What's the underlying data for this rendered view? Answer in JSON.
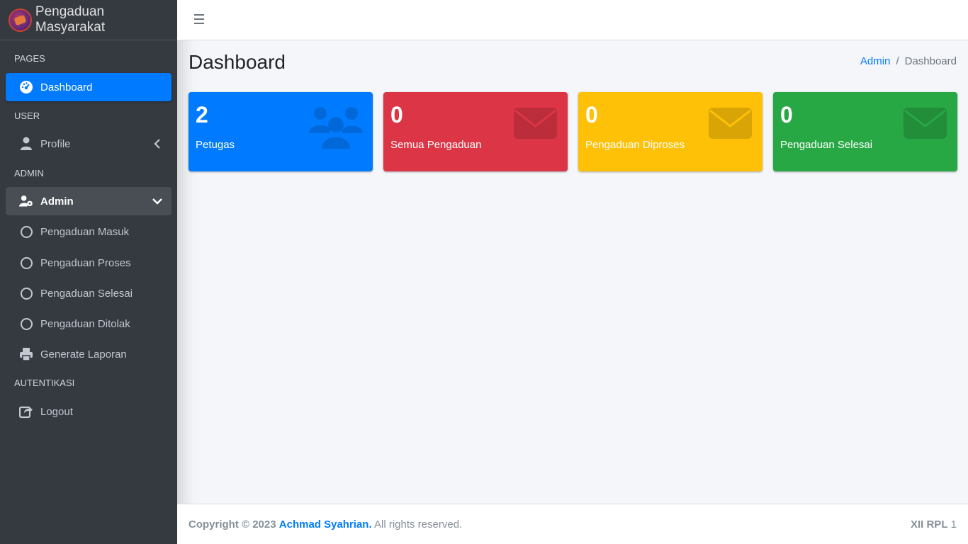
{
  "brand": {
    "title": "Pengaduan Masyarakat"
  },
  "sidebar": {
    "sections": {
      "pages": "PAGES",
      "user": "USER",
      "admin": "ADMIN",
      "auth": "AUTENTIKASI"
    },
    "items": {
      "dashboard": "Dashboard",
      "profile": "Profile",
      "admin": "Admin",
      "pengaduan_masuk": "Pengaduan Masuk",
      "pengaduan_proses": "Pengaduan Proses",
      "pengaduan_selesai": "Pengaduan Selesai",
      "pengaduan_ditolak": "Pengaduan Ditolak",
      "generate_laporan": "Generate Laporan",
      "logout": "Logout"
    }
  },
  "header": {
    "page_title": "Dashboard"
  },
  "breadcrumb": {
    "home": "Admin",
    "separator": "/",
    "current": "Dashboard"
  },
  "cards": [
    {
      "value": "2",
      "label": "Petugas",
      "color": "#007bff",
      "icon": "users-icon"
    },
    {
      "value": "0",
      "label": "Semua Pengaduan",
      "color": "#dc3545",
      "icon": "envelope-icon"
    },
    {
      "value": "0",
      "label": "Pengaduan Diproses",
      "color": "#ffc107",
      "icon": "envelope-icon"
    },
    {
      "value": "0",
      "label": "Pengaduan Selesai",
      "color": "#28a745",
      "icon": "envelope-icon"
    }
  ],
  "footer": {
    "copyright": "Copyright © 2023",
    "author": "Achmad Syahrian.",
    "rights": "All rights reserved.",
    "class_bold": "XII RPL",
    "class_num": "1"
  }
}
